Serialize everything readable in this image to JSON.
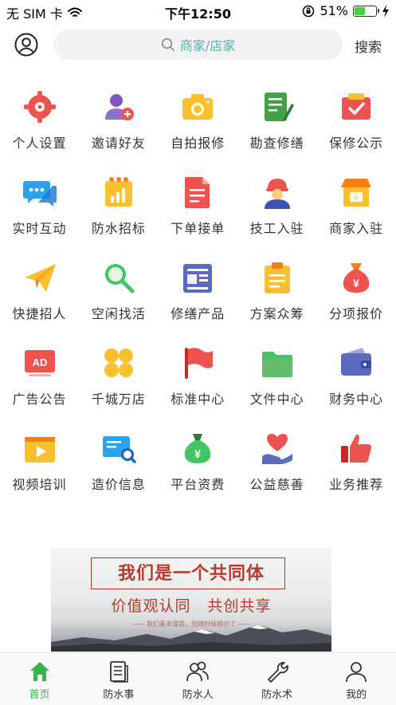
{
  "status_bar": {
    "carrier": "无 SIM 卡",
    "time": "下午12:50",
    "battery_percent_text": "51%",
    "battery_level": 0.51
  },
  "header": {
    "search": {
      "part1": "商家",
      "separator": "/",
      "part2": "店家"
    },
    "search_button": "搜索"
  },
  "grid": [
    {
      "label": "个人设置",
      "icon": "gear-icon",
      "color": "#ef5350"
    },
    {
      "label": "邀请好友",
      "icon": "add-friend-icon",
      "color": "#7e57c2"
    },
    {
      "label": "自拍报修",
      "icon": "camera-icon",
      "color": "#fbc02d"
    },
    {
      "label": "勘查修缮",
      "icon": "notepad-pen-icon",
      "color": "#43a047"
    },
    {
      "label": "保修公示",
      "icon": "badge-check-icon",
      "color": "#ef5350"
    },
    {
      "label": "实时互动",
      "icon": "chat-icon",
      "color": "#29a3ef"
    },
    {
      "label": "防水招标",
      "icon": "tender-chart-icon",
      "color": "#fbc02d"
    },
    {
      "label": "下单接单",
      "icon": "order-doc-icon",
      "color": "#ef5350"
    },
    {
      "label": "技工入驻",
      "icon": "worker-icon",
      "color": "#3f51b5"
    },
    {
      "label": "商家入驻",
      "icon": "storefront-icon",
      "color": "#fbc02d"
    },
    {
      "label": "快捷招人",
      "icon": "paper-plane-icon",
      "color": "#fbc02d"
    },
    {
      "label": "空闲找活",
      "icon": "magnifier-icon",
      "color": "#43c465"
    },
    {
      "label": "修缮产品",
      "icon": "product-list-icon",
      "color": "#5c6bc0"
    },
    {
      "label": "方案众筹",
      "icon": "clipboard-icon",
      "color": "#fbc02d"
    },
    {
      "label": "分项报价",
      "icon": "money-bag-icon",
      "color": "#ef5350"
    },
    {
      "label": "广告公告",
      "icon": "ad-icon",
      "color": "#ef5350"
    },
    {
      "label": "千城万店",
      "icon": "clover-icon",
      "color": "#fbc02d"
    },
    {
      "label": "标准中心",
      "icon": "flag-icon",
      "color": "#ef5350"
    },
    {
      "label": "文件中心",
      "icon": "folder-icon",
      "color": "#43c465"
    },
    {
      "label": "财务中心",
      "icon": "wallet-icon",
      "color": "#5c6bc0"
    },
    {
      "label": "视频培训",
      "icon": "video-icon",
      "color": "#fbc02d"
    },
    {
      "label": "造价信息",
      "icon": "price-search-icon",
      "color": "#29a3ef"
    },
    {
      "label": "平台资费",
      "icon": "yuan-bag-icon",
      "color": "#43c465"
    },
    {
      "label": "公益慈善",
      "icon": "heart-hand-icon",
      "color": "#ef5350"
    },
    {
      "label": "业务推荐",
      "icon": "thumbs-up-icon",
      "color": "#ef5350"
    }
  ],
  "banner": {
    "title": "我们是一个共同体",
    "subtitle": "价值观认同 共创共享",
    "small": "—— 我们素未谋面，但随时候相识了 ——"
  },
  "tabbar": [
    {
      "label": "首页",
      "icon": "home-icon",
      "active": true
    },
    {
      "label": "防水事",
      "icon": "document-icon",
      "active": false
    },
    {
      "label": "防水人",
      "icon": "people-icon",
      "active": false
    },
    {
      "label": "防水术",
      "icon": "wrench-icon",
      "active": false
    },
    {
      "label": "我的",
      "icon": "user-icon",
      "active": false
    }
  ],
  "colors": {
    "accent_green": "#37b24d",
    "search_teal": "#4db6ac",
    "banner_red": "#b83a2b"
  }
}
